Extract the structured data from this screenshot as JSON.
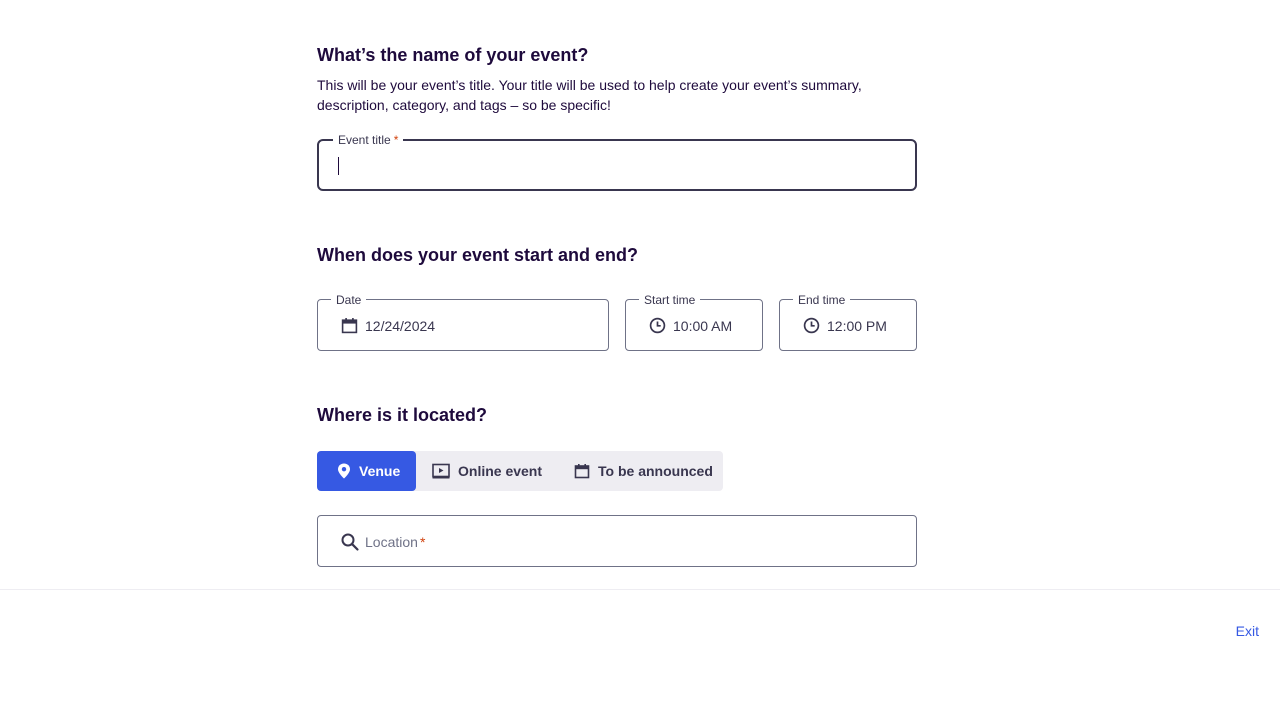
{
  "title_section": {
    "heading": "What’s the name of your event?",
    "description": "This will be your event’s title. Your title will be used to help create your event’s summary, description, category, and tags – so be specific!",
    "field_label": "Event title",
    "required_mark": "*",
    "value": ""
  },
  "datetime_section": {
    "heading": "When does your event start and end?",
    "date": {
      "label": "Date",
      "value": "12/24/2024",
      "icon": "calendar-icon"
    },
    "start": {
      "label": "Start time",
      "value": "10:00 AM",
      "icon": "clock-icon"
    },
    "end": {
      "label": "End time",
      "value": "12:00 PM",
      "icon": "clock-icon"
    }
  },
  "location_section": {
    "heading": "Where is it located?",
    "options": [
      {
        "label": "Venue",
        "icon": "map-pin-icon",
        "selected": true
      },
      {
        "label": "Online event",
        "icon": "video-screen-icon",
        "selected": false
      },
      {
        "label": "To be announced",
        "icon": "calendar-icon",
        "selected": false
      }
    ],
    "search_placeholder": "Location",
    "required_mark": "*",
    "search_icon": "search-icon"
  },
  "footer": {
    "exit_label": "Exit"
  },
  "colors": {
    "primary": "#3659e3",
    "text": "#1e0a3c",
    "required": "#d1410c",
    "segment_bg": "#eeedf2"
  }
}
